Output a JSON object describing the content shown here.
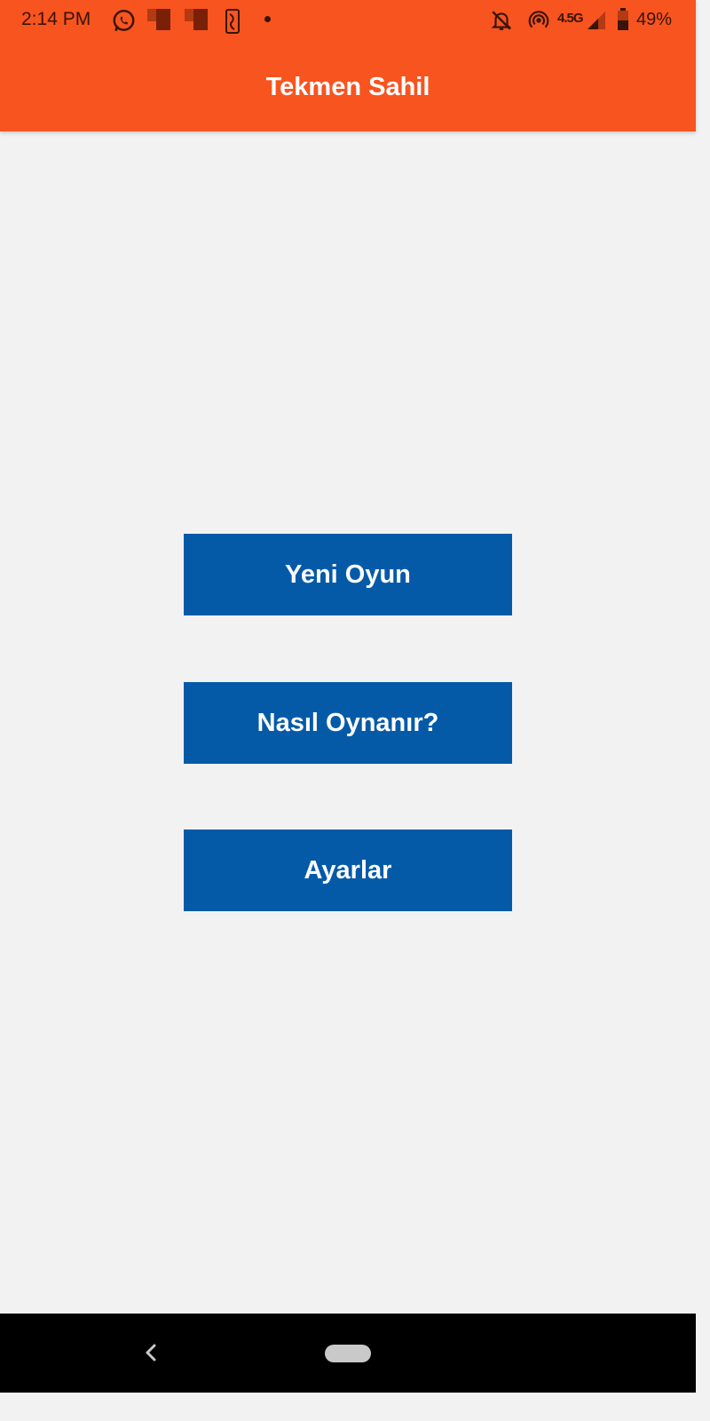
{
  "status_bar": {
    "time": "2:14 PM",
    "network": "4.5G",
    "battery_percent": "49%",
    "icons": [
      "whatsapp-icon",
      "notification-icon",
      "notification-icon",
      "nba-icon",
      "dot-icon",
      "muted-bell-icon",
      "hotspot-icon",
      "network-4.5g-icon",
      "signal-icon",
      "battery-icon"
    ]
  },
  "app_bar": {
    "title": "Tekmen Sahil",
    "color": "#f75420"
  },
  "menu": {
    "new_game": "Yeni Oyun",
    "how_to_play": "Nasıl Oynanır?",
    "settings": "Ayarlar",
    "button_color": "#055aa8"
  },
  "nav_bar": {
    "icons": [
      "back-icon",
      "home-pill-icon"
    ]
  }
}
